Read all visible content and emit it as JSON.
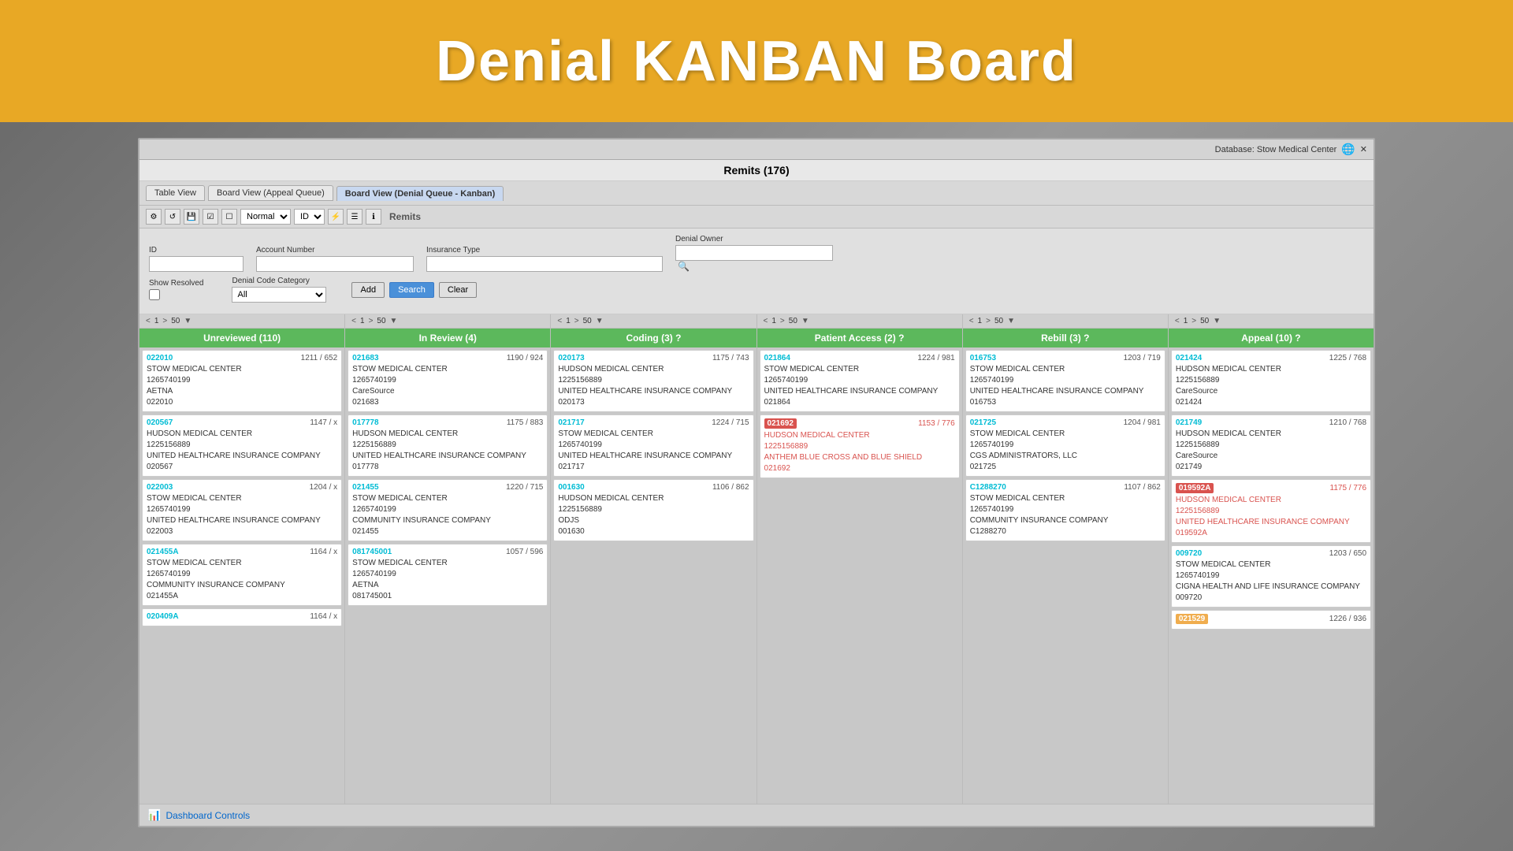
{
  "header": {
    "title": "Denial KANBAN Board"
  },
  "topbar": {
    "database_label": "Database: Stow Medical Center"
  },
  "window": {
    "title": "Remits (176)"
  },
  "tabs": [
    {
      "label": "Table View",
      "active": false
    },
    {
      "label": "Board View (Appeal Queue)",
      "active": false
    },
    {
      "label": "Board View (Denial Queue - Kanban)",
      "active": true
    }
  ],
  "toolbar": {
    "mode": "Normal",
    "sort": "ID",
    "remits_label": "Remits"
  },
  "filters": {
    "id_label": "ID",
    "account_number_label": "Account Number",
    "insurance_type_label": "Insurance Type",
    "denial_owner_label": "Denial Owner",
    "show_resolved_label": "Show Resolved",
    "denial_code_category_label": "Denial Code Category",
    "denial_code_category_value": "All",
    "add_label": "Add",
    "search_label": "Search",
    "clear_label": "Clear"
  },
  "columns": [
    {
      "id": "unreviewed",
      "header": "Unreviewed (110)",
      "pagination": "< 1 > 50 ▼",
      "cards": [
        {
          "id": "022010",
          "id_style": "cyan",
          "amounts": "1211 / 652",
          "line1": "STOW MEDICAL CENTER",
          "line2": "1265740199",
          "line3": "AETNA",
          "line4": "022010"
        },
        {
          "id": "020567",
          "id_style": "cyan",
          "amounts": "1147 / x",
          "line1": "HUDSON MEDICAL CENTER",
          "line2": "1225156889",
          "line3": "UNITED HEALTHCARE INSURANCE COMPANY",
          "line4": "020567"
        },
        {
          "id": "022003",
          "id_style": "cyan",
          "amounts": "1204 / x",
          "line1": "STOW MEDICAL CENTER",
          "line2": "1265740199",
          "line3": "UNITED HEALTHCARE INSURANCE COMPANY",
          "line4": "022003"
        },
        {
          "id": "021455A",
          "id_style": "cyan",
          "amounts": "1164 / x",
          "line1": "STOW MEDICAL CENTER",
          "line2": "1265740199",
          "line3": "COMMUNITY INSURANCE COMPANY",
          "line4": "021455A"
        },
        {
          "id": "020409A",
          "id_style": "cyan",
          "amounts": "1164 / x",
          "line1": "",
          "line2": "",
          "line3": "",
          "line4": ""
        }
      ]
    },
    {
      "id": "inreview",
      "header": "In Review (4)",
      "pagination": "< 1 > 50 ▼",
      "cards": [
        {
          "id": "021683",
          "id_style": "cyan",
          "amounts": "1190 / 924",
          "line1": "STOW MEDICAL CENTER",
          "line2": "1265740199",
          "line3": "CareSource",
          "line4": "021683"
        },
        {
          "id": "017778",
          "id_style": "cyan",
          "amounts": "1175 / 883",
          "line1": "HUDSON MEDICAL CENTER",
          "line2": "1225156889",
          "line3": "UNITED HEALTHCARE INSURANCE COMPANY",
          "line4": "017778"
        },
        {
          "id": "021455",
          "id_style": "cyan",
          "amounts": "1220 / 715",
          "line1": "STOW MEDICAL CENTER",
          "line2": "1265740199",
          "line3": "COMMUNITY INSURANCE COMPANY",
          "line4": "021455"
        },
        {
          "id": "081745001",
          "id_style": "cyan",
          "amounts": "1057 / 596",
          "line1": "STOW MEDICAL CENTER",
          "line2": "1265740199",
          "line3": "AETNA",
          "line4": "081745001"
        }
      ]
    },
    {
      "id": "coding",
      "header": "Coding (3)",
      "pagination": "< 1 > 50 ▼",
      "cards": [
        {
          "id": "020173",
          "id_style": "cyan",
          "amounts": "1175 / 743",
          "line1": "HUDSON MEDICAL CENTER",
          "line2": "1225156889",
          "line3": "UNITED HEALTHCARE INSURANCE COMPANY",
          "line4": "020173"
        },
        {
          "id": "021717",
          "id_style": "cyan",
          "amounts": "1224 / 715",
          "line1": "STOW MEDICAL CENTER",
          "line2": "1265740199",
          "line3": "UNITED HEALTHCARE INSURANCE COMPANY",
          "line4": "021717"
        },
        {
          "id": "001630",
          "id_style": "cyan",
          "amounts": "1106 / 862",
          "line1": "HUDSON MEDICAL CENTER",
          "line2": "1225156889",
          "line3": "ODJS",
          "line4": "001630"
        }
      ]
    },
    {
      "id": "patientaccess",
      "header": "Patient Access (2)",
      "pagination": "< 1 > 50 ▼",
      "cards": [
        {
          "id": "021864",
          "id_style": "cyan",
          "amounts": "1224 / 981",
          "line1": "STOW MEDICAL CENTER",
          "line2": "1265740199",
          "line3": "UNITED HEALTHCARE INSURANCE COMPANY",
          "line4": "021864"
        },
        {
          "id": "021692",
          "id_style": "red",
          "amounts": "1153 / 776",
          "line1": "HUDSON MEDICAL CENTER",
          "line2": "1225156889",
          "line3": "ANTHEM BLUE CROSS AND BLUE SHIELD",
          "line4": "021692"
        }
      ]
    },
    {
      "id": "rebill",
      "header": "Rebill (3)",
      "pagination": "< 1 > 50 ▼",
      "cards": [
        {
          "id": "016753",
          "id_style": "cyan",
          "amounts": "1203 / 719",
          "line1": "STOW MEDICAL CENTER",
          "line2": "1265740199",
          "line3": "UNITED HEALTHCARE INSURANCE COMPANY",
          "line4": "016753"
        },
        {
          "id": "021725",
          "id_style": "cyan",
          "amounts": "1204 / 981",
          "line1": "STOW MEDICAL CENTER",
          "line2": "1265740199",
          "line3": "CGS ADMINISTRATORS, LLC",
          "line4": "021725"
        },
        {
          "id": "C1288270",
          "id_style": "cyan",
          "amounts": "1107 / 862",
          "line1": "STOW MEDICAL CENTER",
          "line2": "1265740199",
          "line3": "COMMUNITY INSURANCE COMPANY",
          "line4": "C1288270"
        }
      ]
    },
    {
      "id": "appeal",
      "header": "Appeal (10)",
      "pagination": "< 1 > 50 ▼",
      "cards": [
        {
          "id": "021424",
          "id_style": "cyan",
          "amounts": "1225 / 768",
          "line1": "HUDSON MEDICAL CENTER",
          "line2": "1225156889",
          "line3": "CareSource",
          "line4": "021424"
        },
        {
          "id": "021749",
          "id_style": "cyan",
          "amounts": "1210 / 768",
          "line1": "HUDSON MEDICAL CENTER",
          "line2": "1225156889",
          "line3": "CareSource",
          "line4": "021749"
        },
        {
          "id": "019592A",
          "id_style": "red",
          "amounts": "1175 / 776",
          "line1": "HUDSON MEDICAL CENTER",
          "line2": "1225156889",
          "line3": "UNITED HEALTHCARE INSURANCE COMPANY",
          "line4": "019592A"
        },
        {
          "id": "009720",
          "id_style": "cyan",
          "amounts": "1203 / 650",
          "line1": "STOW MEDICAL CENTER",
          "line2": "1265740199",
          "line3": "CIGNA HEALTH AND LIFE INSURANCE COMPANY",
          "line4": "009720"
        },
        {
          "id": "021529",
          "id_style": "yellow",
          "amounts": "1226 / 936",
          "line1": "",
          "line2": "",
          "line3": "",
          "line4": ""
        }
      ]
    }
  ],
  "dashboard_controls": {
    "label": "Dashboard Controls"
  }
}
